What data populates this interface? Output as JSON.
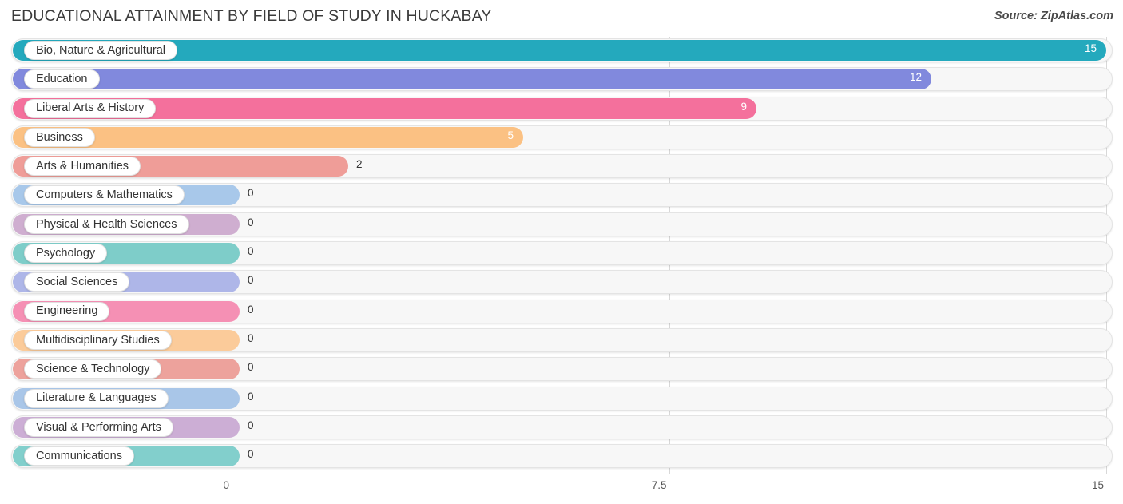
{
  "header": {
    "title": "EDUCATIONAL ATTAINMENT BY FIELD OF STUDY IN HUCKABAY",
    "source": "Source: ZipAtlas.com"
  },
  "chart_data": {
    "type": "bar",
    "orientation": "horizontal",
    "title": "EDUCATIONAL ATTAINMENT BY FIELD OF STUDY IN HUCKABAY",
    "xlabel": "",
    "ylabel": "",
    "xlim": [
      0,
      15
    ],
    "grid": true,
    "legend": "none",
    "xticks": [
      "0",
      "7.5",
      "15"
    ],
    "xtick_values": [
      0,
      7.5,
      15
    ],
    "categories": [
      "Bio, Nature & Agricultural",
      "Education",
      "Liberal Arts & History",
      "Business",
      "Arts & Humanities",
      "Computers & Mathematics",
      "Physical & Health Sciences",
      "Psychology",
      "Social Sciences",
      "Engineering",
      "Multidisciplinary Studies",
      "Science & Technology",
      "Literature & Languages",
      "Visual & Performing Arts",
      "Communications"
    ],
    "values": [
      15,
      12,
      9,
      5,
      2,
      0,
      0,
      0,
      0,
      0,
      0,
      0,
      0,
      0,
      0
    ],
    "value_labels": [
      "15",
      "12",
      "9",
      "5",
      "2",
      "0",
      "0",
      "0",
      "0",
      "0",
      "0",
      "0",
      "0",
      "0",
      "0"
    ],
    "colors": [
      "#24a9bd",
      "#8189dd",
      "#f4709c",
      "#fbc183",
      "#ef9d98",
      "#a8c8ea",
      "#cfaed0",
      "#7ecdc9",
      "#aeb6e8",
      "#f590b4",
      "#fbcb9a",
      "#eda29c",
      "#a9c6e8",
      "#ccaed5",
      "#82cfcc"
    ]
  }
}
